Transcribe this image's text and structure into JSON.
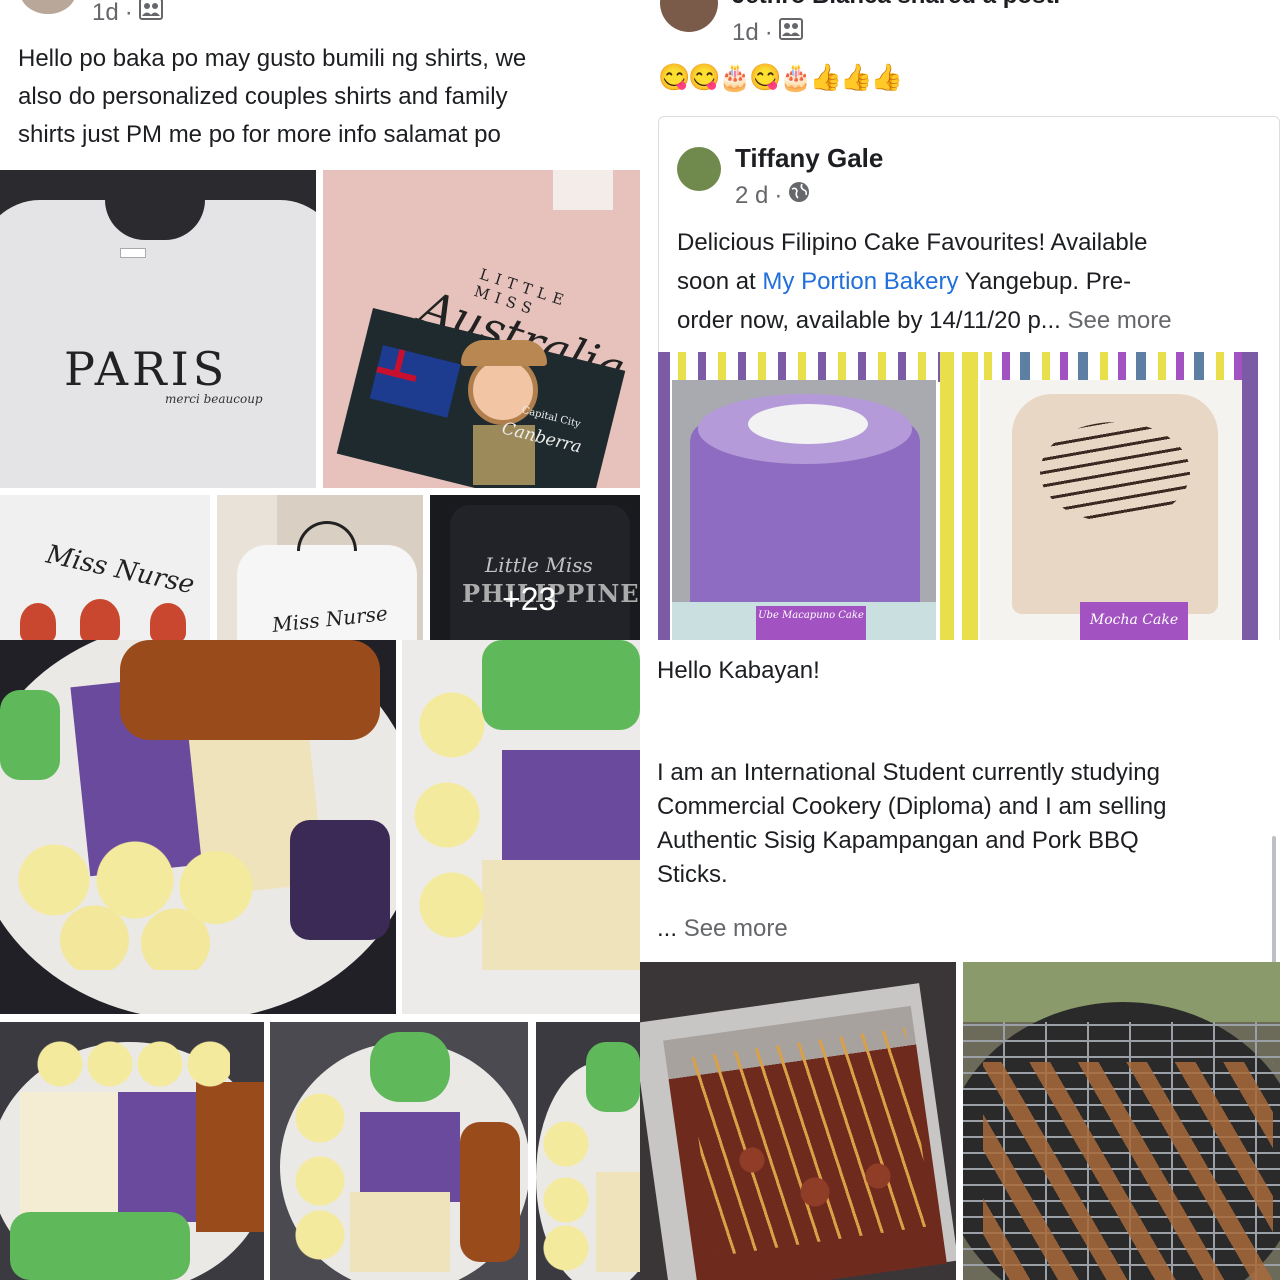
{
  "post1": {
    "time": "1d",
    "dot": "·",
    "audience_icon": "friends-icon",
    "text_lines": [
      "Hello po baka po may gusto bumili ng shirts, we",
      "also do personalized couples shirts and family",
      "shirts just PM me po for more info salamat po"
    ],
    "shirt_paris": {
      "brand": "PARIS",
      "sub": "merci beaucoup"
    },
    "shirt_australia": {
      "top": "LITTLE MISS",
      "main": "Australia",
      "city_label": "Capital City",
      "city": "Canberra"
    },
    "shirt_nurse": "Miss Nurse",
    "shirt_nurse2": "Miss Nurse",
    "shirt_ph": {
      "top": "Little Miss",
      "main": "PHILIPPINES"
    },
    "more_photos": "+23"
  },
  "post2": {
    "header_partial": "Jethro Blanca shared a post.",
    "time": "1d",
    "dot": "·",
    "audience_icon": "friends-icon",
    "emojis": "😋😋🎂😋🎂👍👍👍",
    "shared": {
      "author": "Tiffany Gale",
      "time": "2 d",
      "dot": "·",
      "audience_icon": "globe-icon",
      "text_before_link": "Delicious Filipino Cake Favourites! Available",
      "text_line2_pre": "soon at ",
      "link": "My Portion Bakery",
      "text_line2_post": " Yangebup. Pre-",
      "text_line3": "order now, available by 14/11/20 p...",
      "see_more": "See more",
      "cake1_label": "Ube Macapuno Cake",
      "cake2_label": "Mocha Cake"
    }
  },
  "post3": {
    "greeting": "Hello Kabayan!",
    "text_lines": [
      "I am an International Student currently studying",
      "Commercial Cookery (Diploma) and I am selling",
      "Authentic Sisig Kapampangan and Pork BBQ",
      "Sticks."
    ],
    "see_more_prefix": "...",
    "see_more": "See more"
  },
  "colors": {
    "text": "#1c1e21",
    "meta": "#65676b",
    "link": "#216fdb",
    "ube": "#7b5aa6",
    "mocha_label": "#a252c1"
  }
}
